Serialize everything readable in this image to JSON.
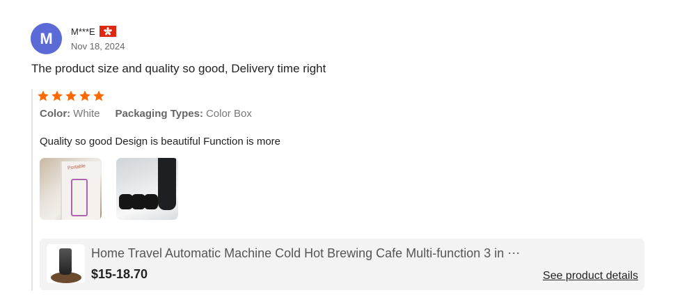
{
  "reviewer": {
    "avatar_letter": "M",
    "avatar_color": "#5b6ad6",
    "name": "M***E",
    "flag_icon": "hong-kong-flag-icon",
    "date": "Nov 18, 2024"
  },
  "review": {
    "headline": "The product size and quality so good, Delivery time right",
    "rating": 5,
    "star_color": "#ff6a00",
    "attributes": [
      {
        "label": "Color:",
        "value": "White"
      },
      {
        "label": "Packaging Types:",
        "value": "Color Box"
      }
    ],
    "comment": "Quality so good Design is beautiful Function is more",
    "photos": [
      "review-photo-box",
      "review-photo-bottle"
    ]
  },
  "product": {
    "name": "Home Travel Automatic Machine Cold Hot Brewing Cafe Multi-function 3 in ⋯",
    "price": "$15-18.70",
    "details_link": "See product details"
  }
}
